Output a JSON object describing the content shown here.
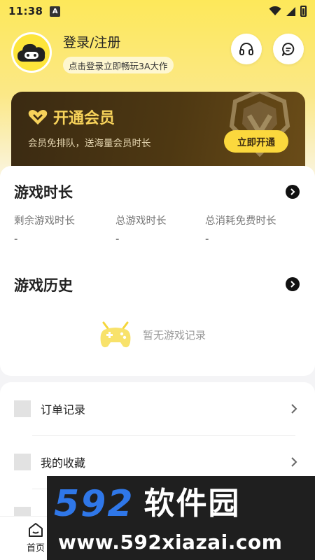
{
  "status_bar": {
    "time": "11:38",
    "notification_icon_letter": "A"
  },
  "header": {
    "login_title": "登录/注册",
    "login_subtitle": "点击登录立即畅玩3A大作",
    "avatar_icon": "cloud-gamepad-icon",
    "support_icon": "headset-icon",
    "message_icon": "chat-bubble-icon"
  },
  "vip": {
    "title": "开通会员",
    "description": "会员免排队，送海量会员时长",
    "button": "立即开通",
    "accent": "#f7d25a"
  },
  "game_time": {
    "title": "游戏时长",
    "stats": [
      {
        "label": "剩余游戏时长",
        "value": "-"
      },
      {
        "label": "总游戏时长",
        "value": "-"
      },
      {
        "label": "总消耗免费时长",
        "value": "-"
      }
    ]
  },
  "game_history": {
    "title": "游戏历史",
    "empty_text": "暂无游戏记录"
  },
  "menu": {
    "items": [
      {
        "label": "订单记录"
      },
      {
        "label": "我的收藏"
      }
    ]
  },
  "bottom_nav": {
    "home_label": "首页"
  },
  "watermark": {
    "number": "592",
    "brand": "软件园",
    "url": "www.592xiazai.com",
    "accent": "#2f77e8"
  }
}
